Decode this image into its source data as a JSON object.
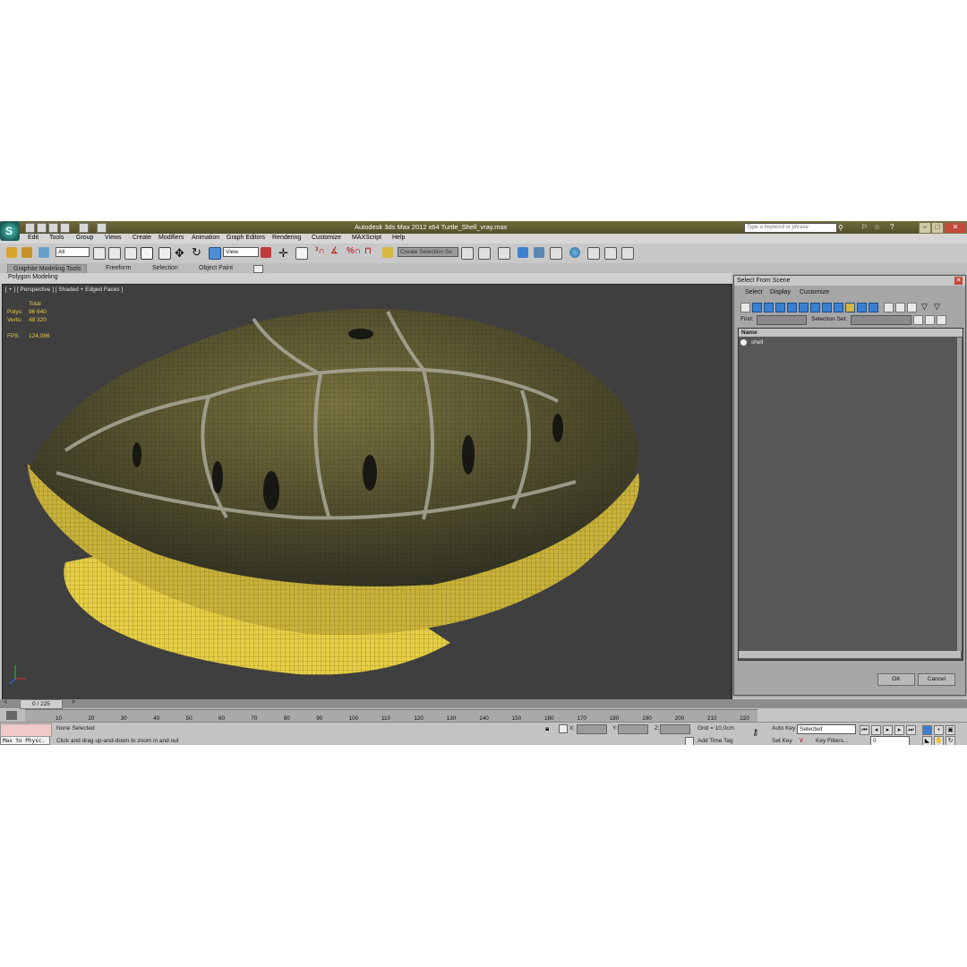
{
  "window": {
    "title": "Autodesk 3ds Max  2012 x64     Turtle_Shell_vray.max",
    "search_placeholder": "Type a keyword or phrase"
  },
  "menu": [
    "Edit",
    "Tools",
    "Group",
    "Views",
    "Create",
    "Modifiers",
    "Animation",
    "Graph Editors",
    "Rendering",
    "Customize",
    "MAXScript",
    "Help"
  ],
  "toolbar": {
    "selection_filter": "All",
    "reference_coord": "View",
    "named_selection": "Create Selection Se"
  },
  "ribbon": {
    "tabs": [
      "Graphite Modeling Tools",
      "Freeform",
      "Selection",
      "Object Paint"
    ],
    "panel": "Polygon Modeling"
  },
  "viewport": {
    "label": "[ + ] [ Perspective ] [ Shaded + Edged Faces ]",
    "stats": {
      "header": "Total",
      "polys_label": "Polys:",
      "polys": "96 640",
      "verts_label": "Verts:",
      "verts": "48 320",
      "fps_label": "FPS:",
      "fps": "124,086"
    }
  },
  "dialog": {
    "title": "Select From Scene",
    "menu": [
      "Select",
      "Display",
      "Customize"
    ],
    "find_label": "Find:",
    "selection_set_label": "Selection Set:",
    "column_name": "Name",
    "items": [
      "shell"
    ],
    "ok": "OK",
    "cancel": "Cancel"
  },
  "timeline": {
    "frame": "0 / 225",
    "ticks": [
      "10",
      "20",
      "30",
      "40",
      "50",
      "60",
      "70",
      "80",
      "90",
      "100",
      "110",
      "120",
      "130",
      "140",
      "150",
      "160",
      "170",
      "180",
      "190",
      "200",
      "210",
      "220"
    ]
  },
  "status": {
    "script_text": "Max to Physc.",
    "selection": "None Selected",
    "prompt": "Click and drag up-and-down to zoom in and out",
    "x_label": "X:",
    "y_label": "Y:",
    "z_label": "Z:",
    "grid": "Grid = 10,0cm",
    "add_time_tag": "Add Time Tag",
    "auto_key": "Auto Key",
    "set_key": "Set Key",
    "key_mode": "Selected",
    "key_filters": "Key Filters...",
    "frame_field": "0"
  },
  "colors": {
    "stats": "#e7c84a",
    "viewport_bg": "#3f3f3f",
    "accent": "#3b7fd0"
  }
}
